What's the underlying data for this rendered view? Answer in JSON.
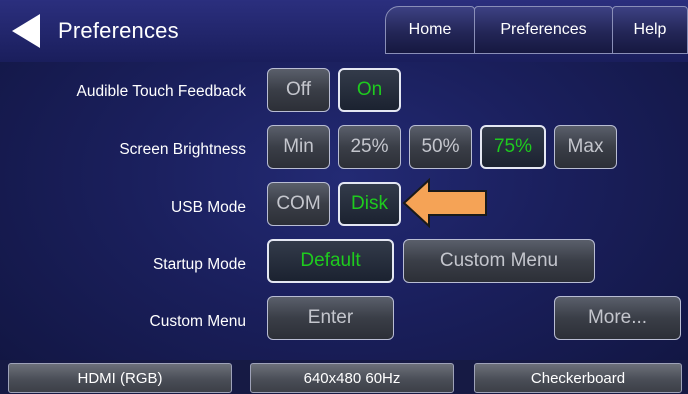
{
  "header": {
    "title": "Preferences",
    "tabs": [
      {
        "label": "Home"
      },
      {
        "label": "Preferences"
      },
      {
        "label": "Help"
      }
    ]
  },
  "rows": {
    "audible_touch_feedback": {
      "label": "Audible Touch Feedback",
      "options": [
        "Off",
        "On"
      ],
      "selected": "On"
    },
    "screen_brightness": {
      "label": "Screen Brightness",
      "options": [
        "Min",
        "25%",
        "50%",
        "75%",
        "Max"
      ],
      "selected": "75%"
    },
    "usb_mode": {
      "label": "USB Mode",
      "options": [
        "COM",
        "Disk"
      ],
      "selected": "Disk"
    },
    "startup_mode": {
      "label": "Startup Mode",
      "options": [
        "Default",
        "Custom Menu"
      ],
      "selected": "Default"
    },
    "custom_menu": {
      "label": "Custom Menu",
      "enter_label": "Enter",
      "more_label": "More..."
    }
  },
  "status_bar": {
    "items": [
      "HDMI (RGB)",
      "640x480 60Hz",
      "Checkerboard"
    ]
  },
  "colors": {
    "selected_text": "#1ecb1e",
    "annotation_arrow": "#f5a356",
    "background": "#1a1f5c"
  }
}
